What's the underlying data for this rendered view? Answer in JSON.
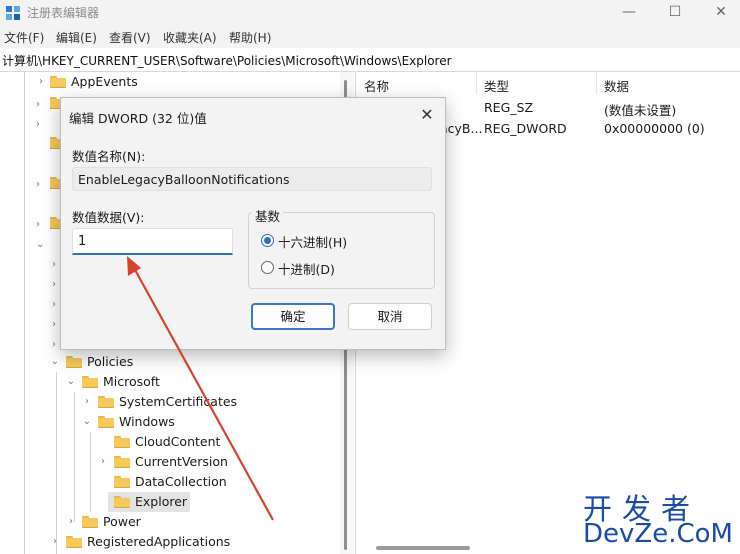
{
  "window": {
    "title": "注册表编辑器",
    "controls": {
      "minimize": "—",
      "maximize": "☐",
      "close": "✕"
    }
  },
  "menu": [
    "文件(F)",
    "编辑(E)",
    "查看(V)",
    "收藏夹(A)",
    "帮助(H)"
  ],
  "address": "计算机\\HKEY_CURRENT_USER\\Software\\Policies\\Microsoft\\Windows\\Explorer",
  "tree": {
    "items": [
      {
        "label": "AppEvents"
      },
      {
        "label": "Policies"
      },
      {
        "label": "Microsoft"
      },
      {
        "label": "SystemCertificates"
      },
      {
        "label": "Windows"
      },
      {
        "label": "CloudContent"
      },
      {
        "label": "CurrentVersion"
      },
      {
        "label": "DataCollection"
      },
      {
        "label": "Explorer"
      },
      {
        "label": "Power"
      },
      {
        "label": "RegisteredApplications"
      }
    ]
  },
  "list": {
    "headers": [
      "名称",
      "类型",
      "数据"
    ],
    "rows": [
      {
        "name": "",
        "type": "REG_SZ",
        "data": "(数值未设置)"
      },
      {
        "name": "acyB...",
        "type": "REG_DWORD",
        "data": "0x00000000 (0)"
      }
    ]
  },
  "dialog": {
    "title": "编辑 DWORD (32 位)值",
    "close": "✕",
    "name_label": "数值名称(N):",
    "name_value": "EnableLegacyBalloonNotifications",
    "value_label": "数值数据(V):",
    "value_value": "1",
    "base_label": "基数",
    "hex_label": "十六进制(H)",
    "dec_label": "十进制(D)",
    "selected_base": "hex",
    "ok": "确定",
    "cancel": "取消"
  },
  "watermark": {
    "top": "开发者",
    "bottom": "DevZe.CoM"
  },
  "colors": {
    "accent": "#2f6fc0",
    "folder": "#f6c95c",
    "annotation_arrow": "#d9412f",
    "watermark": "#1d4aa8"
  }
}
